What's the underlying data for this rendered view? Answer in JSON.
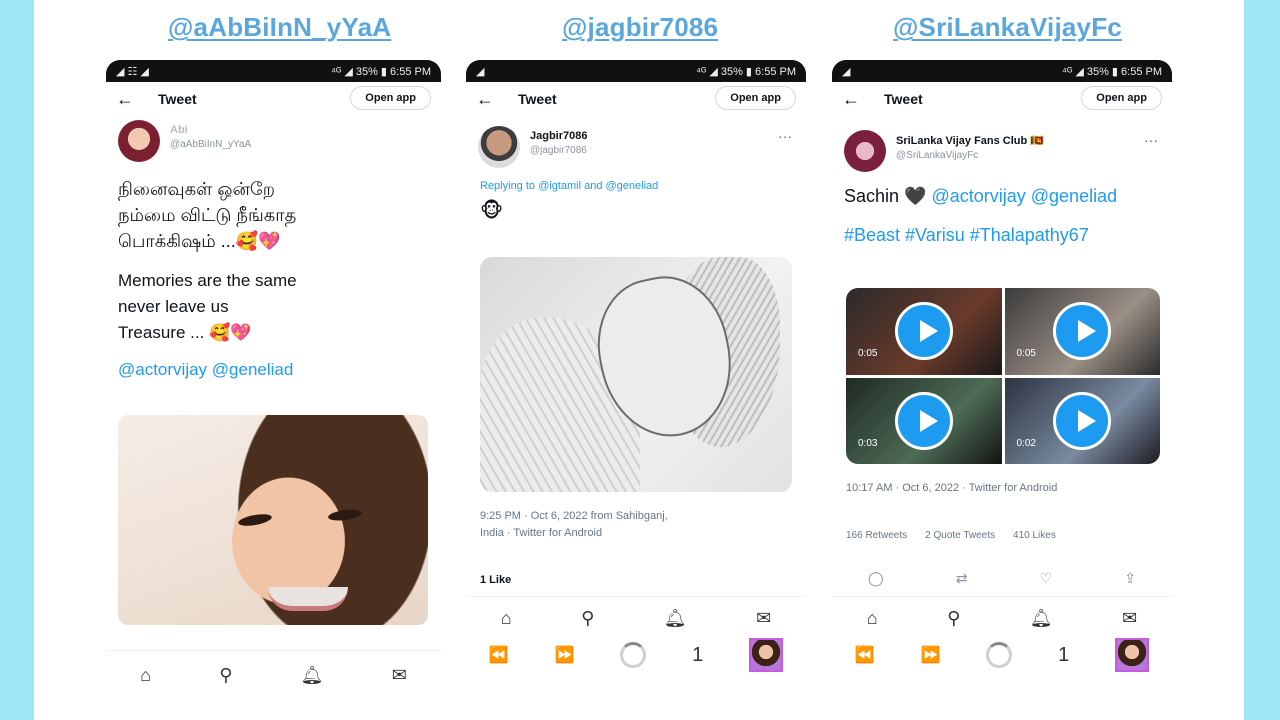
{
  "handles": {
    "left": "@aAbBiInN_yYaA",
    "center": "@jagbir7086",
    "right": "@SriLankaVijayFc"
  },
  "common": {
    "topbar_title": "Tweet",
    "open_app": "Open app",
    "nav_icons": [
      "home-icon",
      "search-icon",
      "notifications-icon",
      "messages-icon"
    ],
    "player_counter": "1"
  },
  "phone1": {
    "status_left": "◢ ☷ ◢",
    "status_right": "⁴ᴳ ◢ 35% ▮ 6:55 PM",
    "user_name": "Abi",
    "user_handle": "@aAbBiInN_yYaA",
    "tamil_text": "நினைவுகள் ஒன்றே\nநம்மை விட்டு நீங்காத\nபொக்கிஷம் ...🥰💖",
    "english_text": "Memories are the same\nnever leave us\nTreasure ... 🥰💖",
    "mentions": "@actorvijay @geneliad"
  },
  "phone2": {
    "status_right": "⁴ᴳ ◢ 35% ▮ 6:55 PM",
    "user_name": "Jagbir7086",
    "user_handle": "@jagbir7086",
    "reply_to": "Replying to @igtamil and @geneliad",
    "emoji": "🐵",
    "timestamp": "9:25 PM · Oct 6, 2022 from Sahibganj,\nIndia · Twitter for Android",
    "likes": "1 Like"
  },
  "phone3": {
    "status_right": "⁴ᴳ ◢ 35% ▮ 6:55 PM",
    "user_name": "SriLanka Vijay Fans Club 🇱🇰",
    "user_handle": "@SriLankaVijayFc",
    "text_prefix": "Sachin 🖤",
    "mentions": "@actorvijay @geneliad",
    "hashtags": "#Beast #Varisu #Thalapathy67",
    "videos": [
      {
        "duration": "0:05"
      },
      {
        "duration": "0:05"
      },
      {
        "duration": "0:03"
      },
      {
        "duration": "0:02"
      }
    ],
    "timestamp": "10:17 AM · Oct 6, 2022 · Twitter for Android",
    "retweets": "166 Retweets",
    "quotes": "2 Quote Tweets",
    "likes": "410 Likes"
  },
  "colors": {
    "side_bar": "#9ee6f5",
    "handle": "#5aa7de",
    "link": "#1d9bf0"
  }
}
